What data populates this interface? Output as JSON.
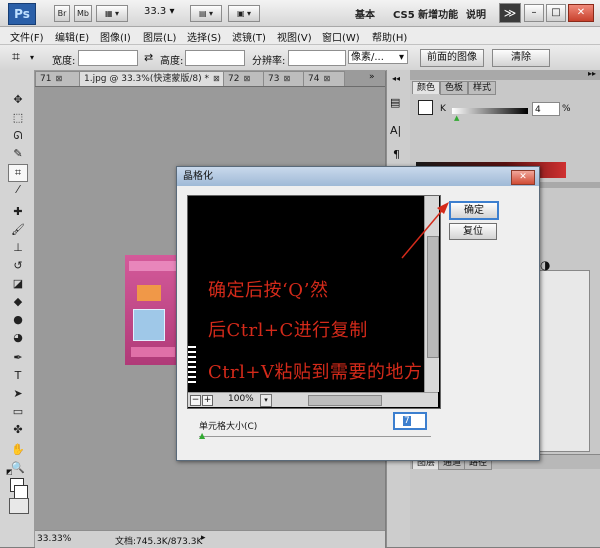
{
  "appbar": {
    "logo": "Ps",
    "btn_br": "Br",
    "btn_mb": "Mb",
    "zoom": "33.3",
    "workspace_basic": "基本",
    "workspace_new": "CS5 新增功能",
    "workspace_help": "说明",
    "more": "≫"
  },
  "menu": {
    "items": [
      "文件(F)",
      "编辑(E)",
      "图像(I)",
      "图层(L)",
      "选择(S)",
      "滤镜(T)",
      "视图(V)",
      "窗口(W)",
      "帮助(H)"
    ]
  },
  "options": {
    "width_label": "宽度:",
    "height_label": "高度:",
    "resolution_label": "分辨率:",
    "unit": "像素/...",
    "front_image_button": "前面的图像",
    "clear_button": "清除"
  },
  "tabs": [
    {
      "label": "71"
    },
    {
      "label": "1.jpg @ 33.3%(快速蒙版/8) *"
    },
    {
      "label": "72"
    },
    {
      "label": "73"
    },
    {
      "label": "74"
    }
  ],
  "panels": {
    "tab_color": "颜色",
    "tab_swatches": "色板",
    "tab_styles": "样式",
    "k_label": "K",
    "k_value": "4",
    "k_unit": "%",
    "tab_layers": "图层",
    "tab_channels": "通道",
    "tab_paths": "路径"
  },
  "status": {
    "zoom": "33.33%",
    "doc": "文档:745.3K/873.3K"
  },
  "dialog": {
    "title": "晶格化",
    "ok": "确定",
    "reset": "复位",
    "zoom": "100%",
    "cell_size_label": "单元格大小(C)",
    "cell_size_value": "7"
  },
  "annotation": {
    "line1": "确定后按‘Q’然",
    "line2": "后Ctrl+C进行复制",
    "line3": "Ctrl+V粘贴到需要的地方"
  },
  "colors": {
    "annotation": "#d42a1a",
    "dialog_title": "#b3c9e2",
    "canvas": "#9a9a9a"
  }
}
